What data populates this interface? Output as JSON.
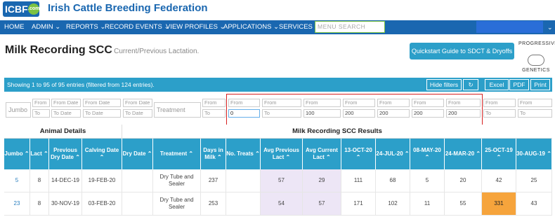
{
  "header": {
    "logo_text": "ICBF",
    "logo_badge": ".com",
    "org_name": "Irish Cattle Breeding Federation"
  },
  "nav": {
    "items": [
      "HOME",
      "ADMIN ⌄",
      "REPORTS ⌄",
      "RECORD EVENTS ⌄",
      "VIEW PROFILES ⌄",
      "APPLICATIONS ⌄",
      "SERVICES ⌄"
    ],
    "search_placeholder": "MENU SEARCH",
    "chevron": "⌄"
  },
  "page": {
    "title": "Milk Recording SCC",
    "subtitle": "- Current/Previous Lactation.",
    "quickstart_label": "Quickstart Guide to SDCT & Dryoffs",
    "partner_logo": {
      "line1": "PROGRESSIVE",
      "line2": "GENETICS"
    }
  },
  "table_bar": {
    "info": "Showing 1 to 95 of 95 entries (filtered from 124 entries).",
    "hide_filters": "Hide filters",
    "refresh_icon": "↻",
    "excel": "Excel",
    "pdf": "PDF",
    "print": "Print"
  },
  "filters": {
    "jumbo": "Jumbo",
    "lact": {
      "from": "From",
      "to": "To"
    },
    "prev_dry": {
      "from": "From Date",
      "to": "To Date"
    },
    "calving": {
      "from": "From Date",
      "to": "To Date"
    },
    "dry_date": {
      "from": "From Date",
      "to": "To Date"
    },
    "treatment": "Treatment",
    "days_in_milk": {
      "from": "From",
      "to": "To"
    },
    "no_treats": {
      "from": "From",
      "to": "0"
    },
    "avg_prev": {
      "from": "From",
      "to": "To"
    },
    "avg_curr": {
      "from": "From",
      "to": "100"
    },
    "d13oct20": {
      "from": "From",
      "to": "200"
    },
    "d24jul20": {
      "from": "From",
      "to": "200"
    },
    "d08may20": {
      "from": "From",
      "to": "200"
    },
    "d24mar20": {
      "from": "From",
      "to": "200"
    },
    "d25oct19": {
      "from": "From",
      "to": "To"
    },
    "d30aug19": {
      "from": "From",
      "to": "To"
    }
  },
  "table": {
    "group_animal": "Animal Details",
    "group_results": "Milk Recording SCC Results",
    "columns": [
      "Jumbo ⌃",
      "Lact ⌃",
      "Previous Dry Date ⌃",
      "Calving Date ⌃",
      "Dry Date ⌃",
      "Treatment ⌃",
      "Days in Milk ⌃",
      "No. Treats ⌃",
      "Avg Previous Lact ⌃",
      "Avg Current Lact ⌃",
      "13-OCT-20 ⌃",
      "24-JUL-20 ⌃",
      "08-MAY-20 ⌃",
      "24-MAR-20 ⌃",
      "25-OCT-19 ⌃",
      "30-AUG-19 ⌃"
    ],
    "rows": [
      [
        "5",
        "8",
        "14-DEC-19",
        "19-FEB-20",
        "",
        "Dry Tube and Sealer",
        "237",
        "",
        "57",
        "29",
        "111",
        "68",
        "5",
        "20",
        "42",
        "25"
      ],
      [
        "23",
        "8",
        "30-NOV-19",
        "03-FEB-20",
        "",
        "Dry Tube and Sealer",
        "253",
        "",
        "54",
        "57",
        "171",
        "102",
        "11",
        "55",
        "331",
        "43"
      ]
    ]
  },
  "colors": {
    "brand_blue": "#1a67b0",
    "table_blue": "#2c9fc9",
    "accent_green": "#7cc242",
    "highlight_orange": "#f6a43c",
    "lavender": "#ede6f6",
    "filter_border_red": "#d62020"
  }
}
